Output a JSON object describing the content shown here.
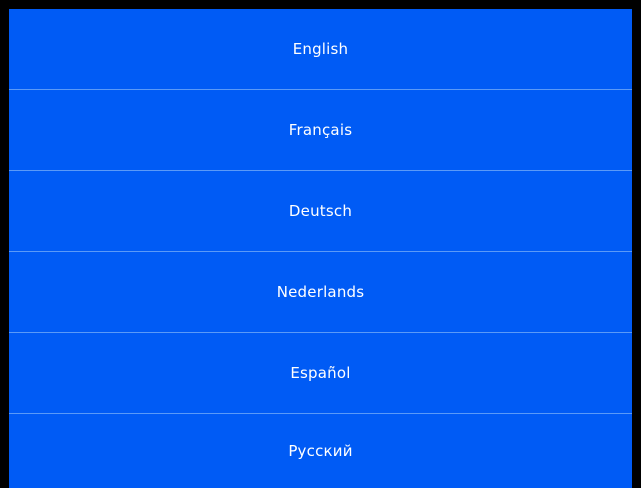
{
  "colors": {
    "background": "#005bf5",
    "border": "#000000",
    "divider": "#5a9af8",
    "text": "#ffffff"
  },
  "languages": [
    {
      "label": "English"
    },
    {
      "label": "Français"
    },
    {
      "label": "Deutsch"
    },
    {
      "label": "Nederlands"
    },
    {
      "label": "Español"
    },
    {
      "label": "Русский"
    }
  ]
}
